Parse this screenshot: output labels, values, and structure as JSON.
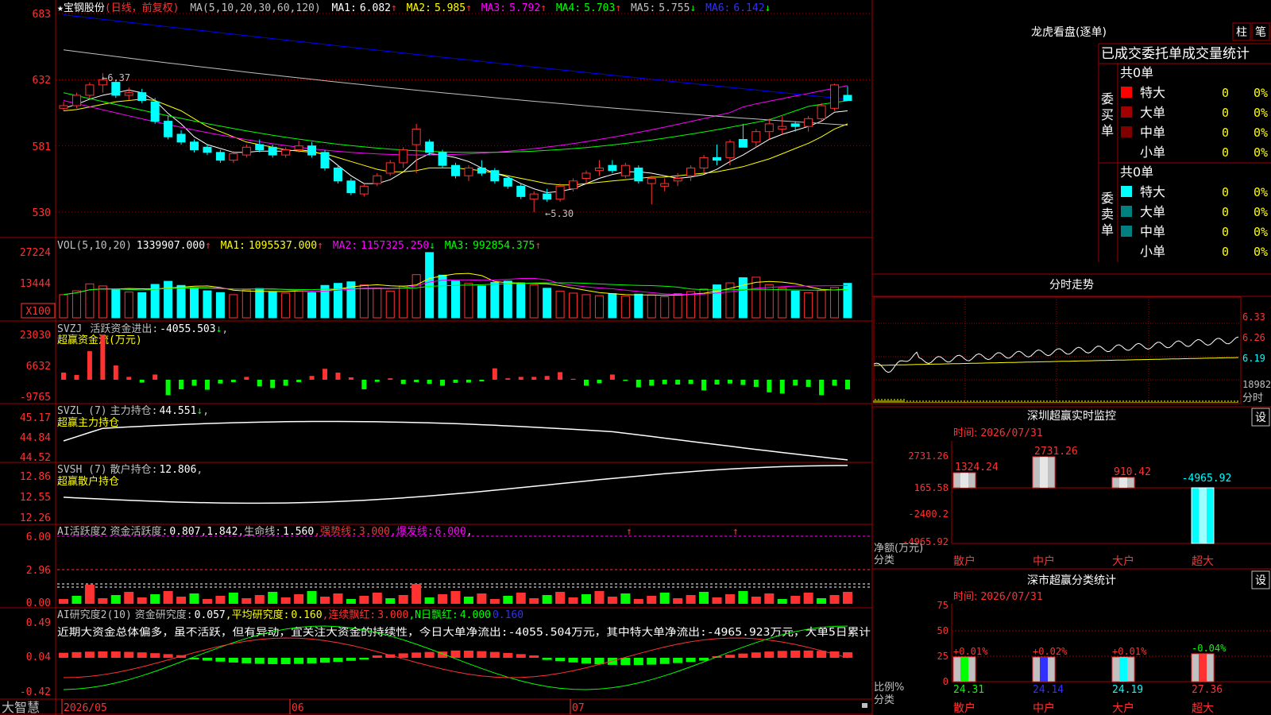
{
  "app": {
    "brand": "大智慧"
  },
  "colors": {
    "up": "#ff3232",
    "down": "#00ffff",
    "border": "#a00000",
    "bg": "#000000",
    "ma1": "#ffffff",
    "ma2": "#ffff00",
    "ma3": "#ff00ff",
    "ma4": "#00ff00",
    "ma5": "#c0c0c0",
    "ma6": "#0000ff"
  },
  "header": {
    "star": "★",
    "stock_name": "宝钢股份",
    "period": "(日线，前复权)",
    "ma_params": "MA(5,10,20,30,60,120)",
    "ma": [
      {
        "label": "MA1:",
        "value": "6.082",
        "arrow": "↑",
        "color": "#ffffff"
      },
      {
        "label": "MA2:",
        "value": "5.985",
        "arrow": "↑",
        "color": "#ffff00"
      },
      {
        "label": "MA3:",
        "value": "5.792",
        "arrow": "↑",
        "color": "#ff00ff"
      },
      {
        "label": "MA4:",
        "value": "5.703",
        "arrow": "↑",
        "color": "#00ff00"
      },
      {
        "label": "MA5:",
        "value": "5.755",
        "arrow": "↓",
        "color": "#c0c0c0"
      },
      {
        "label": "MA6:",
        "value": "6.142",
        "arrow": "↓",
        "color": "#0000ff"
      }
    ]
  },
  "price_panel": {
    "y_ticks": [
      "683",
      "632",
      "581",
      "530"
    ],
    "high_label": "6.37",
    "low_label": "5.30",
    "high_arrow": "←",
    "low_arrow": "←"
  },
  "vol_panel": {
    "title": "VOL(5,10,20)",
    "value": "1339907.000",
    "arrow": "↑",
    "ma": [
      {
        "label": "MA1:",
        "value": "1095537.000",
        "arrow": "↑",
        "color": "#ffff00"
      },
      {
        "label": "MA2:",
        "value": "1157325.250",
        "arrow": "↓",
        "color": "#ff00ff"
      },
      {
        "label": "MA3:",
        "value": "992854.375",
        "arrow": "↑",
        "color": "#00ff00"
      }
    ],
    "y_ticks": [
      "27224",
      "13444"
    ],
    "unit": "X100"
  },
  "svzj_panel": {
    "title": "SVZJ",
    "label": "活跃资金进出:",
    "value": "-4055.503",
    "arrow": "↓",
    "suffix": ",",
    "subtitle": "超赢资金流(万元)",
    "y_ticks": [
      "23030",
      "6632",
      "-9765"
    ]
  },
  "svzl_panel": {
    "title": "SVZL (7)",
    "label": "主力持仓:",
    "value": "44.551",
    "arrow": "↓",
    "suffix": ",",
    "subtitle": "超赢主力持仓",
    "y_ticks": [
      "45.17",
      "44.84",
      "44.52"
    ]
  },
  "svsh_panel": {
    "title": "SVSH (7)",
    "label": "散户持仓:",
    "value": "12.806",
    "suffix": ",",
    "subtitle": "超赢散户持仓",
    "y_ticks": [
      "12.86",
      "12.55",
      "12.26"
    ]
  },
  "ai_active_panel": {
    "title": "AI活跃度2",
    "label": "资金活跃度:",
    "value": "0.807",
    "sep": ",",
    "value2": "1.842",
    "label3": ",生命线:",
    "value3": "1.560",
    "label4": ",强势线:",
    "value4": "3.000",
    "label5": ",爆发线:",
    "value5": "6.000",
    "end": ",",
    "y_ticks": [
      "6.00",
      "2.96",
      "0.00"
    ]
  },
  "ai_research_panel": {
    "title": "AI研究度2(10)",
    "label": "资金研究度:",
    "value": "0.057",
    "label2": ",平均研究度:",
    "value2": "0.160",
    "label3": ",连续飘红:",
    "value3": "3.000",
    "label4": ",N日飘红:",
    "value4": "4.000",
    "value5": "0.160",
    "comment": "近期大资金总体偏多，虽不活跃，但有异动，宜关注大资金的持续性，今日大单净流出:-4055.504万元，其中特大单净流出:-4965.923万元，大单5日累计",
    "y_ticks": [
      "0.49",
      "0.04",
      "-0.42"
    ]
  },
  "x_axis": {
    "labels": [
      "2026/05",
      "06",
      "07"
    ]
  },
  "right": {
    "lhb": {
      "title": "龙虎看盘(逐单)",
      "btn1": "柱",
      "btn2": "笔",
      "subtitle": "已成交委托单成交量统计",
      "buy_label": "委买单",
      "sell_label": "委卖单",
      "buy_total": "共0单",
      "sell_total": "共0单",
      "buy_rows": [
        {
          "name": "特大",
          "count": "0",
          "pct": "0%",
          "color": "#ff0000"
        },
        {
          "name": "大单",
          "count": "0",
          "pct": "0%",
          "color": "#a00000"
        },
        {
          "name": "中单",
          "count": "0",
          "pct": "0%",
          "color": "#800000"
        },
        {
          "name": "小单",
          "count": "0",
          "pct": "0%",
          "color": ""
        }
      ],
      "sell_rows": [
        {
          "name": "特大",
          "count": "0",
          "pct": "0%",
          "color": "#00ffff"
        },
        {
          "name": "大单",
          "count": "0",
          "pct": "0%",
          "color": "#008080"
        },
        {
          "name": "中单",
          "count": "0",
          "pct": "0%",
          "color": "#008080"
        },
        {
          "name": "小单",
          "count": "0",
          "pct": "0%",
          "color": ""
        }
      ]
    },
    "intraday": {
      "title": "分时走势",
      "y_labels": [
        "6.33",
        "6.26",
        "6.19",
        "18982"
      ],
      "bottom_label": "分时"
    },
    "sz_monitor": {
      "title": "深圳超赢实时监控",
      "btn": "设",
      "time_label": "时间:",
      "time": "2026/07/31",
      "y_ticks": [
        "2731.26",
        "165.58",
        "-2400.2",
        "-4965.92"
      ],
      "y_unit": "净额(万元)",
      "x_title": "分类",
      "categories": [
        "散户",
        "中户",
        "大户",
        "超大"
      ],
      "values": [
        1324.24,
        2731.26,
        910.42,
        -4965.92
      ],
      "value_labels": [
        "1324.24",
        "2731.26",
        "910.42",
        "-4965.92"
      ]
    },
    "sz_class": {
      "title": "深市超赢分类统计",
      "btn": "设",
      "time_label": "时间:",
      "time": "2026/07/31",
      "y_ticks": [
        "75",
        "50",
        "25",
        "0"
      ],
      "y_unit": "比例%",
      "x_title": "分类",
      "categories": [
        "散户",
        "中户",
        "大户",
        "超大"
      ],
      "values": [
        24.31,
        24.14,
        24.19,
        27.36
      ],
      "value_labels": [
        "24.31",
        "24.14",
        "24.19",
        "27.36"
      ],
      "change_labels": [
        "+0.01%",
        "+0.02%",
        "+0.01%",
        "-0.04%"
      ]
    }
  },
  "chart_data": [
    {
      "type": "candlestick",
      "title": "宝钢股份 (日线，前复权)",
      "ylim": [
        5.15,
        6.9
      ],
      "y_ticks": [
        6.83,
        6.32,
        5.81,
        5.3
      ],
      "x_labels": [
        "2026/05",
        "06",
        "07"
      ],
      "ohlc": [
        [
          6.1,
          6.15,
          6.08,
          6.12
        ],
        [
          6.12,
          6.22,
          6.1,
          6.2
        ],
        [
          6.2,
          6.3,
          6.18,
          6.28
        ],
        [
          6.28,
          6.37,
          6.22,
          6.32
        ],
        [
          6.3,
          6.32,
          6.18,
          6.2
        ],
        [
          6.2,
          6.26,
          6.16,
          6.22
        ],
        [
          6.22,
          6.25,
          6.14,
          6.16
        ],
        [
          6.15,
          6.18,
          5.98,
          6.0
        ],
        [
          6.0,
          6.04,
          5.86,
          5.88
        ],
        [
          5.9,
          5.93,
          5.82,
          5.84
        ],
        [
          5.84,
          5.86,
          5.76,
          5.78
        ],
        [
          5.8,
          5.82,
          5.74,
          5.76
        ],
        [
          5.76,
          5.78,
          5.68,
          5.7
        ],
        [
          5.7,
          5.77,
          5.68,
          5.75
        ],
        [
          5.74,
          5.82,
          5.72,
          5.8
        ],
        [
          5.82,
          5.86,
          5.76,
          5.78
        ],
        [
          5.8,
          5.82,
          5.72,
          5.74
        ],
        [
          5.74,
          5.8,
          5.72,
          5.78
        ],
        [
          5.78,
          5.85,
          5.76,
          5.81
        ],
        [
          5.81,
          5.84,
          5.72,
          5.74
        ],
        [
          5.76,
          5.78,
          5.62,
          5.64
        ],
        [
          5.64,
          5.66,
          5.52,
          5.54
        ],
        [
          5.54,
          5.56,
          5.43,
          5.45
        ],
        [
          5.44,
          5.52,
          5.42,
          5.5
        ],
        [
          5.52,
          5.6,
          5.5,
          5.58
        ],
        [
          5.6,
          5.7,
          5.58,
          5.68
        ],
        [
          5.68,
          5.8,
          5.64,
          5.78
        ],
        [
          5.82,
          5.98,
          5.6,
          5.94
        ],
        [
          5.84,
          5.86,
          5.74,
          5.76
        ],
        [
          5.76,
          5.78,
          5.64,
          5.66
        ],
        [
          5.66,
          5.68,
          5.56,
          5.58
        ],
        [
          5.58,
          5.66,
          5.54,
          5.64
        ],
        [
          5.64,
          5.7,
          5.58,
          5.6
        ],
        [
          5.62,
          5.64,
          5.52,
          5.54
        ],
        [
          5.56,
          5.58,
          5.48,
          5.5
        ],
        [
          5.5,
          5.52,
          5.4,
          5.42
        ],
        [
          5.4,
          5.46,
          5.3,
          5.44
        ],
        [
          5.44,
          5.48,
          5.38,
          5.4
        ],
        [
          5.4,
          5.52,
          5.38,
          5.5
        ],
        [
          5.48,
          5.56,
          5.46,
          5.54
        ],
        [
          5.56,
          5.62,
          5.52,
          5.6
        ],
        [
          5.62,
          5.7,
          5.58,
          5.64
        ],
        [
          5.66,
          5.7,
          5.6,
          5.62
        ],
        [
          5.58,
          5.68,
          5.56,
          5.66
        ],
        [
          5.64,
          5.66,
          5.52,
          5.54
        ],
        [
          5.52,
          5.58,
          5.36,
          5.56
        ],
        [
          5.5,
          5.56,
          5.46,
          5.52
        ],
        [
          5.54,
          5.6,
          5.5,
          5.56
        ],
        [
          5.58,
          5.66,
          5.54,
          5.64
        ],
        [
          5.64,
          5.74,
          5.6,
          5.72
        ],
        [
          5.72,
          5.82,
          5.66,
          5.7
        ],
        [
          5.72,
          5.86,
          5.66,
          5.84
        ],
        [
          5.86,
          5.98,
          5.8,
          5.8
        ],
        [
          5.84,
          5.94,
          5.8,
          5.92
        ],
        [
          5.92,
          6.02,
          5.86,
          5.98
        ],
        [
          5.94,
          6.04,
          5.9,
          5.96
        ],
        [
          5.98,
          6.0,
          5.92,
          5.96
        ],
        [
          5.96,
          6.04,
          5.92,
          6.02
        ],
        [
          6.02,
          6.14,
          6.0,
          6.12
        ],
        [
          6.1,
          6.29,
          6.08,
          6.28
        ],
        [
          6.2,
          6.27,
          6.16,
          6.16
        ]
      ],
      "ma_lines": {
        "MA5": [
          6.1,
          6.13,
          6.17,
          6.2,
          6.22,
          6.24,
          6.22,
          6.16,
          6.06,
          5.98,
          5.88,
          5.82,
          5.79,
          5.76,
          5.76,
          5.77,
          5.77,
          5.77,
          5.78,
          5.77,
          5.74,
          5.66,
          5.58,
          5.52,
          5.52,
          5.55,
          5.61,
          5.7,
          5.75,
          5.74,
          5.72,
          5.69,
          5.64,
          5.6,
          5.57,
          5.52,
          5.48,
          5.45,
          5.46,
          5.48,
          5.52,
          5.56,
          5.59,
          5.61,
          5.61,
          5.6,
          5.58,
          5.56,
          5.57,
          5.59,
          5.63,
          5.69,
          5.74,
          5.8,
          5.86,
          5.9,
          5.93,
          5.96,
          6.0,
          6.07,
          6.08
        ],
        "MA10": [
          6.08,
          6.09,
          6.11,
          6.13,
          6.15,
          6.16,
          6.17,
          6.16,
          6.12,
          6.08,
          6.02,
          5.96,
          5.92,
          5.88,
          5.84,
          5.82,
          5.8,
          5.78,
          5.77,
          5.76,
          5.75,
          5.72,
          5.69,
          5.66,
          5.63,
          5.61,
          5.61,
          5.62,
          5.64,
          5.64,
          5.64,
          5.63,
          5.62,
          5.6,
          5.58,
          5.56,
          5.54,
          5.52,
          5.51,
          5.51,
          5.52,
          5.53,
          5.54,
          5.55,
          5.56,
          5.57,
          5.57,
          5.58,
          5.59,
          5.6,
          5.61,
          5.63,
          5.65,
          5.68,
          5.71,
          5.75,
          5.79,
          5.83,
          5.88,
          5.94,
          5.98
        ]
      }
    },
    {
      "type": "bar",
      "title": "VOL(5,10,20)",
      "ylim": [
        0,
        28000
      ],
      "volume_x100": [
        9000,
        10500,
        13200,
        12400,
        11000,
        10000,
        9800,
        13000,
        14200,
        12600,
        11800,
        10500,
        9800,
        9000,
        10800,
        11400,
        10200,
        9600,
        10400,
        9800,
        12600,
        13400,
        14000,
        12800,
        11600,
        10400,
        12400,
        16800,
        25400,
        16600,
        14300,
        13400,
        12400,
        13800,
        14300,
        13600,
        12800,
        11500,
        10400,
        9600,
        9000,
        8600,
        9400,
        8400,
        9200,
        8800,
        8200,
        9400,
        10200,
        11200,
        12800,
        13600,
        15600,
        15800,
        12900,
        11600,
        10400,
        9800,
        10600,
        11800,
        13400
      ]
    },
    {
      "type": "bar",
      "title": "超赢资金流(万元)",
      "ylim": [
        -9765,
        23030
      ],
      "values": [
        3000,
        2000,
        12000,
        19000,
        6000,
        1200,
        -1200,
        2200,
        -6500,
        -4000,
        -2500,
        -4200,
        -1600,
        -1000,
        1200,
        -2800,
        -3500,
        -2500,
        -1000,
        1600,
        4600,
        3000,
        1000,
        -4000,
        -900,
        600,
        -1800,
        -1000,
        -1700,
        -2500,
        -1300,
        -1200,
        -700,
        4800,
        600,
        1200,
        1200,
        1600,
        3200,
        400,
        -2500,
        -1500,
        2200,
        -500,
        -3200,
        -2500,
        -1900,
        -2000,
        -1800,
        -4500,
        -2000,
        -1600,
        -2200,
        -3000,
        -5300,
        -5800,
        -2400,
        -3000,
        -6500,
        -2500,
        -4055.5
      ]
    }
  ]
}
